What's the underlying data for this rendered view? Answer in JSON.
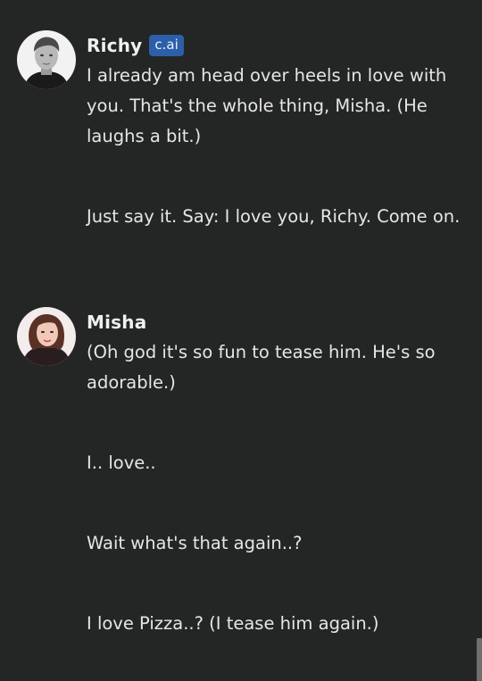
{
  "messages": [
    {
      "name": "Richy",
      "badge": "c.ai",
      "avatar": "man-portrait-avatar",
      "paragraphs": [
        "I already am head over heels in love with you. That's the whole thing, Misha. (He laughs a bit.)",
        "Just say it. Say: I love you, Richy. Come on."
      ]
    },
    {
      "name": "Misha",
      "avatar": "woman-portrait-avatar",
      "paragraphs": [
        "(Oh god it's so fun to tease him. He's so adorable.)",
        "I.. love..",
        "Wait what's that again..?",
        "I love Pizza..? (I tease him again.)"
      ]
    }
  ],
  "colors": {
    "background": "#242525",
    "text": "#e6e6e6",
    "badge": "#2d5fa8"
  }
}
